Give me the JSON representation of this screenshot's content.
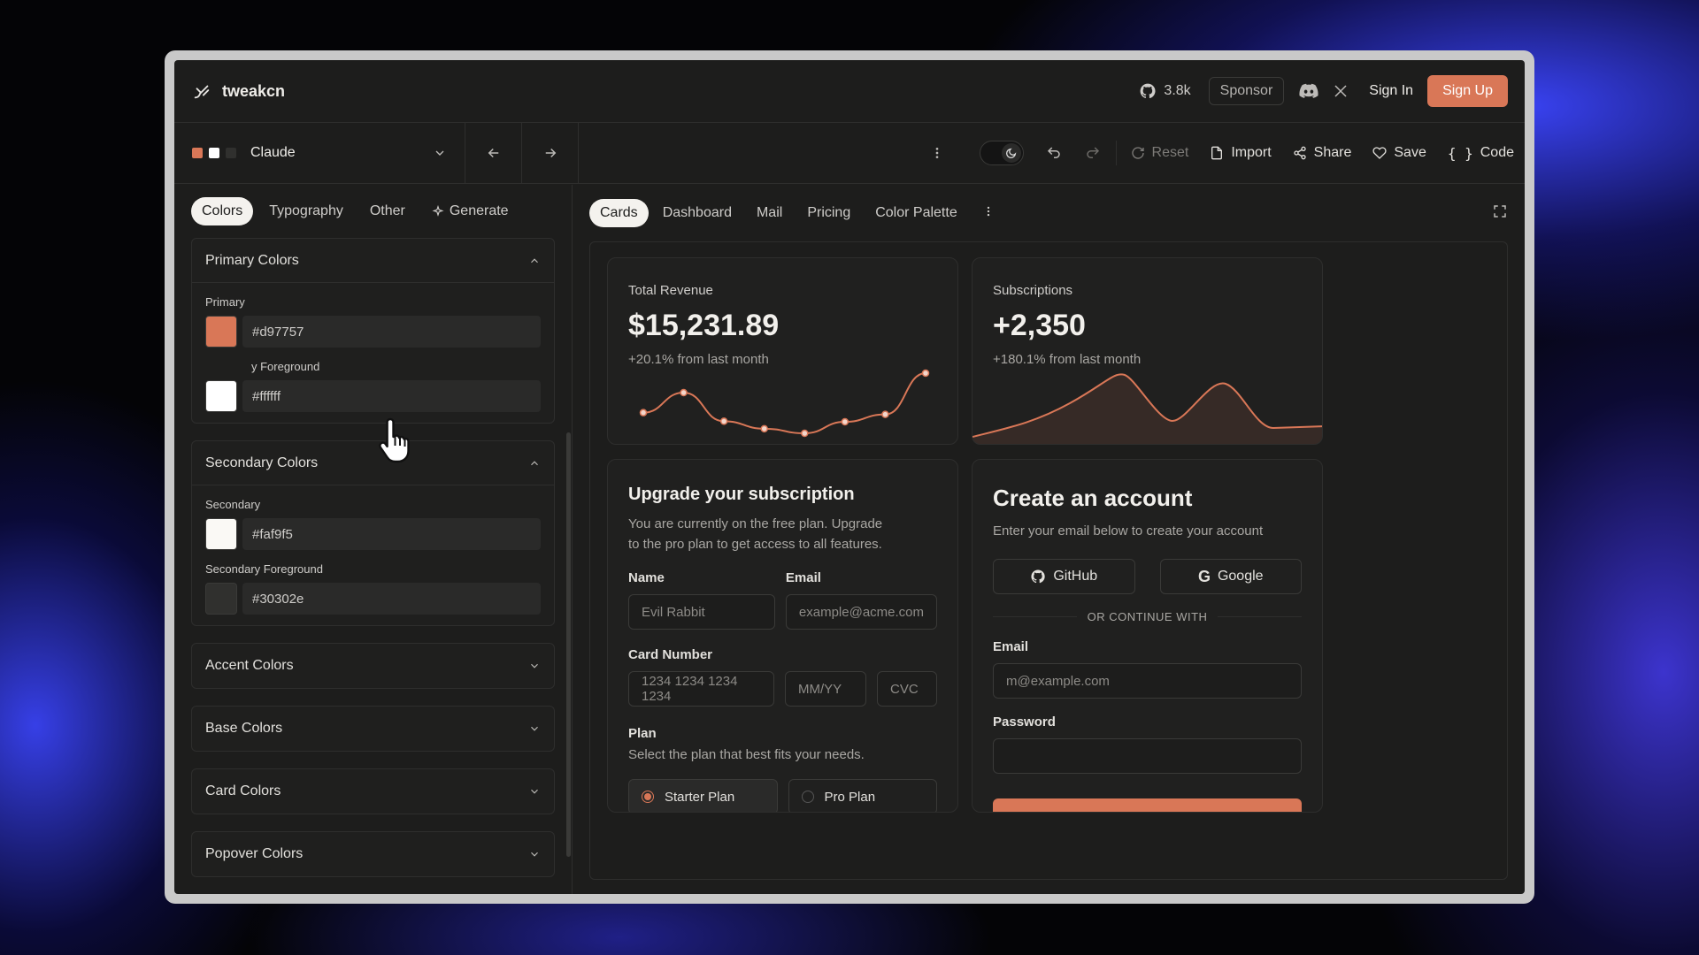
{
  "brand": {
    "name": "tweakcn"
  },
  "topbar": {
    "github_stars": "3.8k",
    "sponsor_label": "Sponsor",
    "signin_label": "Sign In",
    "signup_label": "Sign Up"
  },
  "toolbar": {
    "theme_name": "Claude",
    "theme_dots": [
      "#d97757",
      "#ffffff",
      "#30302e"
    ],
    "reset_label": "Reset",
    "import_label": "Import",
    "share_label": "Share",
    "save_label": "Save",
    "code_label": "Code"
  },
  "left_tabs": [
    "Colors",
    "Typography",
    "Other",
    "Generate"
  ],
  "sections": {
    "primary": {
      "title": "Primary Colors",
      "fields": [
        {
          "label": "Primary",
          "value": "#d97757",
          "swatch": "#d97757"
        },
        {
          "label": "y Foreground",
          "value": "#ffffff",
          "swatch": "#ffffff"
        }
      ]
    },
    "secondary": {
      "title": "Secondary Colors",
      "fields": [
        {
          "label": "Secondary",
          "value": "#faf9f5",
          "swatch": "#faf9f5"
        },
        {
          "label": "Secondary Foreground",
          "value": "#30302e",
          "swatch": "#30302e"
        }
      ]
    },
    "collapsed": [
      "Accent Colors",
      "Base Colors",
      "Card Colors",
      "Popover Colors"
    ]
  },
  "right_tabs": [
    "Cards",
    "Dashboard",
    "Mail",
    "Pricing",
    "Color Palette"
  ],
  "revenue": {
    "label": "Total Revenue",
    "value": "$15,231.89",
    "sub": "+20.1% from last month",
    "points": [
      10400,
      13900,
      8900,
      7600,
      6800,
      8800,
      10100,
      17300
    ]
  },
  "subscriptions": {
    "label": "Subscriptions",
    "value": "+2,350",
    "sub": "+180.1% from last month"
  },
  "upgrade": {
    "title": "Upgrade your subscription",
    "desc1": "You are currently on the free plan. Upgrade",
    "desc2": "to the pro plan to get access to all features.",
    "name_label": "Name",
    "name_value": "Evil Rabbit",
    "email_label": "Email",
    "email_placeholder": "example@acme.com",
    "card_label": "Card Number",
    "card_placeholder": "1234 1234 1234 1234",
    "mmyy_placeholder": "MM/YY",
    "cvc_placeholder": "CVC",
    "plan_label": "Plan",
    "plan_desc": "Select the plan that best fits your needs.",
    "plan_starter": "Starter Plan",
    "plan_pro": "Pro Plan"
  },
  "account": {
    "title": "Create an account",
    "desc": "Enter your email below to create your account",
    "github_label": "GitHub",
    "google_label": "Google",
    "or_text": "OR CONTINUE WITH",
    "email_label": "Email",
    "email_placeholder": "m@example.com",
    "password_label": "Password"
  },
  "colors": {
    "accent": "#d97757"
  }
}
